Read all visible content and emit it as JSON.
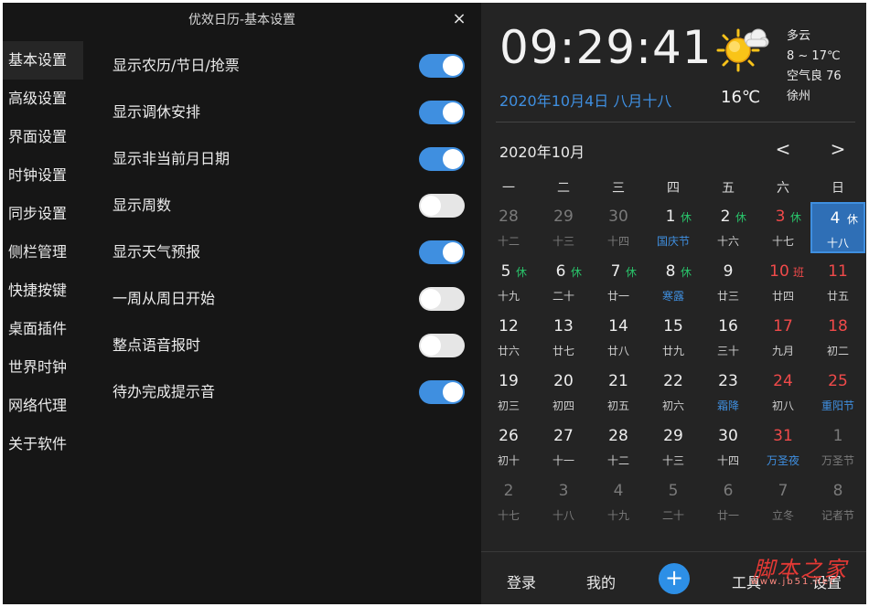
{
  "settings": {
    "title": "优效日历-基本设置",
    "close_label": "×",
    "nav": [
      {
        "label": "基本设置",
        "active": true
      },
      {
        "label": "高级设置"
      },
      {
        "label": "界面设置"
      },
      {
        "label": "时钟设置"
      },
      {
        "label": "同步设置"
      },
      {
        "label": "侧栏管理"
      },
      {
        "label": "快捷按键"
      },
      {
        "label": "桌面插件"
      },
      {
        "label": "世界时钟"
      },
      {
        "label": "网络代理"
      },
      {
        "label": "关于软件"
      }
    ],
    "options": [
      {
        "label": "显示农历/节日/抢票",
        "on": true
      },
      {
        "label": "显示调休安排",
        "on": true
      },
      {
        "label": "显示非当前月日期",
        "on": true
      },
      {
        "label": "显示周数",
        "on": false
      },
      {
        "label": "显示天气预报",
        "on": true
      },
      {
        "label": "一周从周日开始",
        "on": false
      },
      {
        "label": "整点语音报时",
        "on": false
      },
      {
        "label": "待办完成提示音",
        "on": true
      }
    ]
  },
  "calendar": {
    "clock": "09:29:41",
    "date": "2020年10月4日 八月十八",
    "temp": "16℃",
    "weather": {
      "condition": "多云",
      "range": "8 ~ 17℃",
      "aqi": "空气良 76",
      "city": "徐州",
      "icon": "sun-cloud-icon"
    },
    "month": "2020年10月",
    "prev": "<",
    "next": ">",
    "weekdays": [
      "一",
      "二",
      "三",
      "四",
      "五",
      "六",
      "日"
    ],
    "weeks": [
      [
        {
          "d": "28",
          "l": "十二",
          "other": true
        },
        {
          "d": "29",
          "l": "十三",
          "other": true
        },
        {
          "d": "30",
          "l": "十四",
          "other": true
        },
        {
          "d": "1",
          "l": "国庆节",
          "tag": "休",
          "fest": true
        },
        {
          "d": "2",
          "l": "十六",
          "tag": "休"
        },
        {
          "d": "3",
          "l": "十七",
          "tag": "休",
          "weekend": true
        },
        {
          "d": "4",
          "l": "十八",
          "tag": "休",
          "today": true
        }
      ],
      [
        {
          "d": "5",
          "l": "十九",
          "tag": "休"
        },
        {
          "d": "6",
          "l": "二十",
          "tag": "休"
        },
        {
          "d": "7",
          "l": "廿一",
          "tag": "休"
        },
        {
          "d": "8",
          "l": "寒露",
          "tag": "休",
          "fest": true
        },
        {
          "d": "9",
          "l": "廿三"
        },
        {
          "d": "10",
          "l": "廿四",
          "tag": "班",
          "weekend": true,
          "ban": true
        },
        {
          "d": "11",
          "l": "廿五",
          "weekend": true
        }
      ],
      [
        {
          "d": "12",
          "l": "廿六"
        },
        {
          "d": "13",
          "l": "廿七"
        },
        {
          "d": "14",
          "l": "廿八"
        },
        {
          "d": "15",
          "l": "廿九"
        },
        {
          "d": "16",
          "l": "三十"
        },
        {
          "d": "17",
          "l": "九月",
          "weekend": true
        },
        {
          "d": "18",
          "l": "初二",
          "weekend": true
        }
      ],
      [
        {
          "d": "19",
          "l": "初三"
        },
        {
          "d": "20",
          "l": "初四"
        },
        {
          "d": "21",
          "l": "初五"
        },
        {
          "d": "22",
          "l": "初六"
        },
        {
          "d": "23",
          "l": "霜降",
          "fest": true
        },
        {
          "d": "24",
          "l": "初八",
          "weekend": true
        },
        {
          "d": "25",
          "l": "重阳节",
          "weekend": true,
          "fest": true
        }
      ],
      [
        {
          "d": "26",
          "l": "初十"
        },
        {
          "d": "27",
          "l": "十一"
        },
        {
          "d": "28",
          "l": "十二"
        },
        {
          "d": "29",
          "l": "十三"
        },
        {
          "d": "30",
          "l": "十四"
        },
        {
          "d": "31",
          "l": "万圣夜",
          "weekend": true,
          "fest": true
        },
        {
          "d": "1",
          "l": "万圣节",
          "other": true
        }
      ],
      [
        {
          "d": "2",
          "l": "十七",
          "other": true
        },
        {
          "d": "3",
          "l": "十八",
          "other": true
        },
        {
          "d": "4",
          "l": "十九",
          "other": true
        },
        {
          "d": "5",
          "l": "二十",
          "other": true
        },
        {
          "d": "6",
          "l": "廿一",
          "other": true
        },
        {
          "d": "7",
          "l": "立冬",
          "other": true
        },
        {
          "d": "8",
          "l": "记者节",
          "other": true
        }
      ]
    ],
    "bottom": {
      "login": "登录",
      "mine": "我的",
      "plus": "+",
      "tools": "工具",
      "settings": "设置"
    },
    "watermark": {
      "text": "脚本之家",
      "url": "www.jb51.net"
    }
  },
  "colors": {
    "accent": "#3f8fe0",
    "rest": "#29c36a",
    "weekend": "#f04a4a",
    "bg_settings": "#161616",
    "bg_calendar": "#242424"
  }
}
